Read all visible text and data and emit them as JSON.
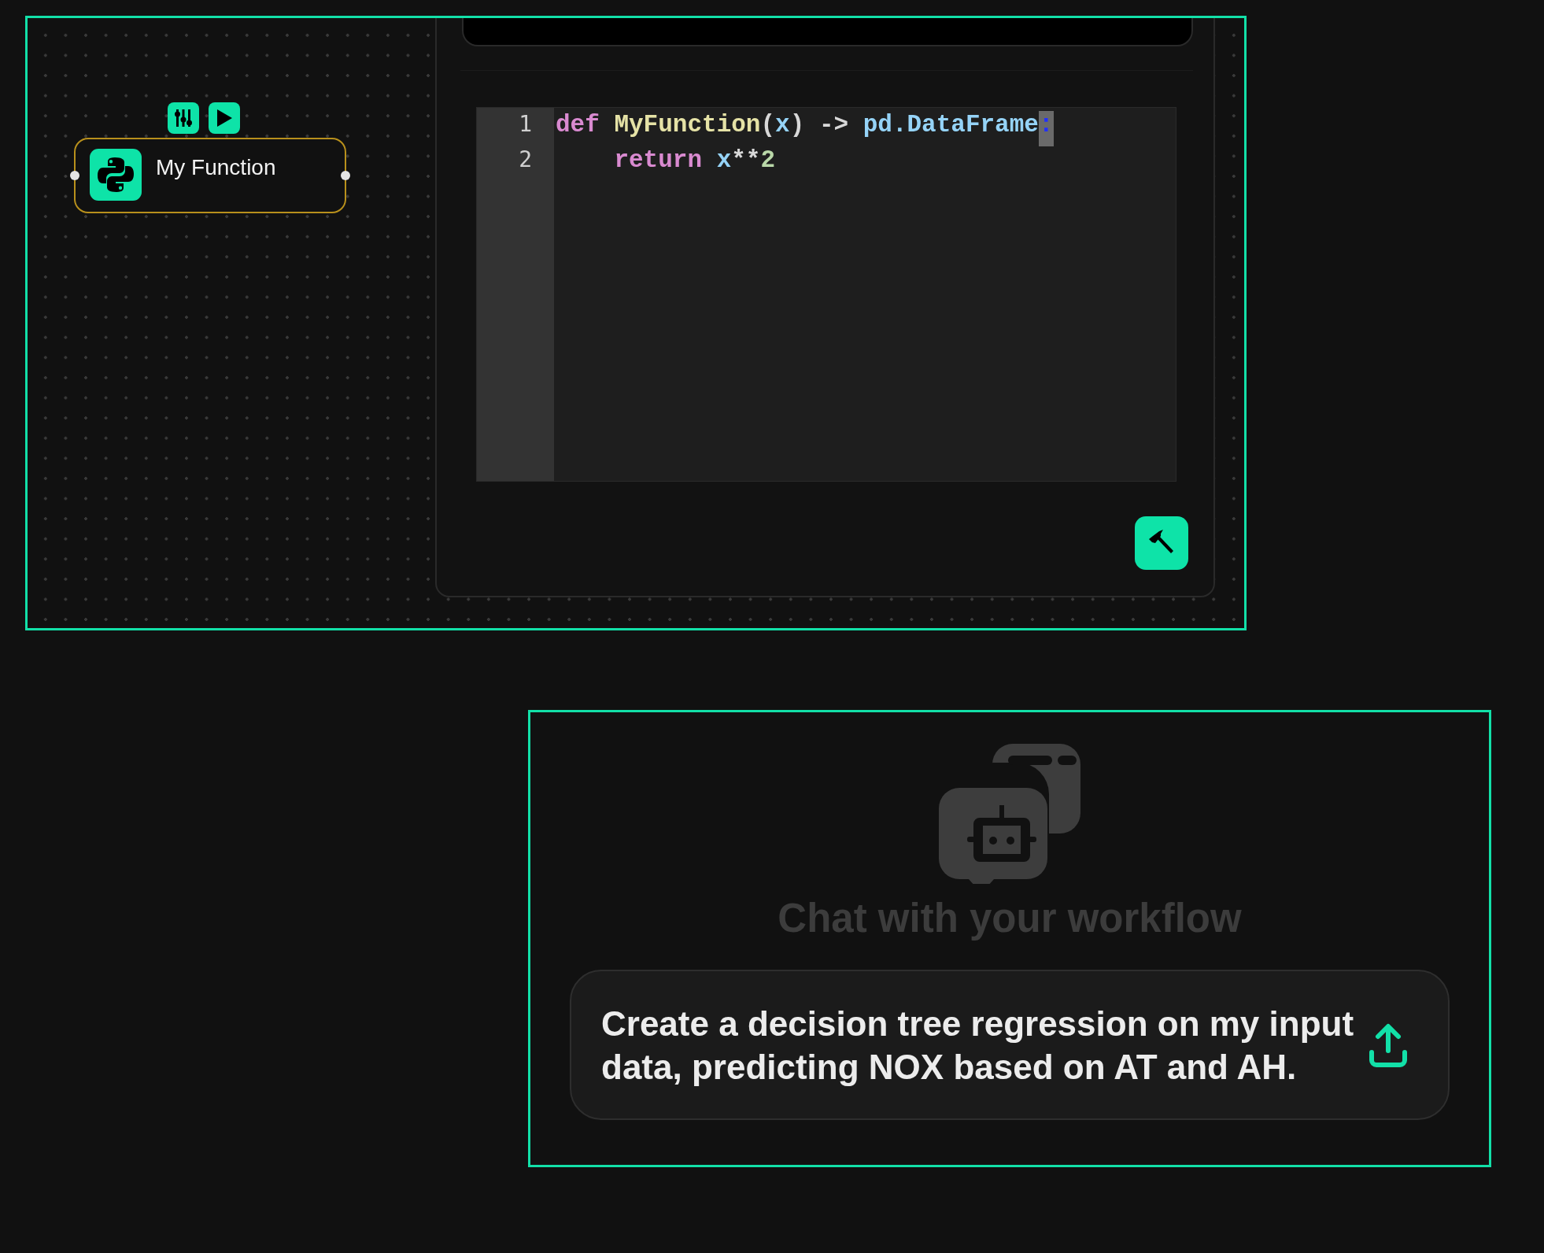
{
  "canvas": {
    "node": {
      "title": "My Function"
    },
    "editor": {
      "lines": [
        {
          "number": "1",
          "tokens": [
            {
              "kind": "keyword",
              "text": "def"
            },
            {
              "kind": "function",
              "text": " MyFunction"
            },
            {
              "kind": "plain",
              "text": "("
            },
            {
              "kind": "variable",
              "text": "x"
            },
            {
              "kind": "plain",
              "text": ") -> "
            },
            {
              "kind": "variable",
              "text": "pd.DataFrame"
            },
            {
              "kind": "matched",
              "text": ":"
            }
          ]
        },
        {
          "number": "2",
          "tokens": [
            {
              "kind": "keyword",
              "text": "    return"
            },
            {
              "kind": "variable",
              "text": " x"
            },
            {
              "kind": "plain",
              "text": "**"
            },
            {
              "kind": "number",
              "text": "2"
            }
          ]
        }
      ]
    }
  },
  "chat": {
    "title": "Chat with your workflow",
    "input": {
      "value": "Create a decision tree regression on my input data, predicting NOX based on AT and AH."
    }
  }
}
